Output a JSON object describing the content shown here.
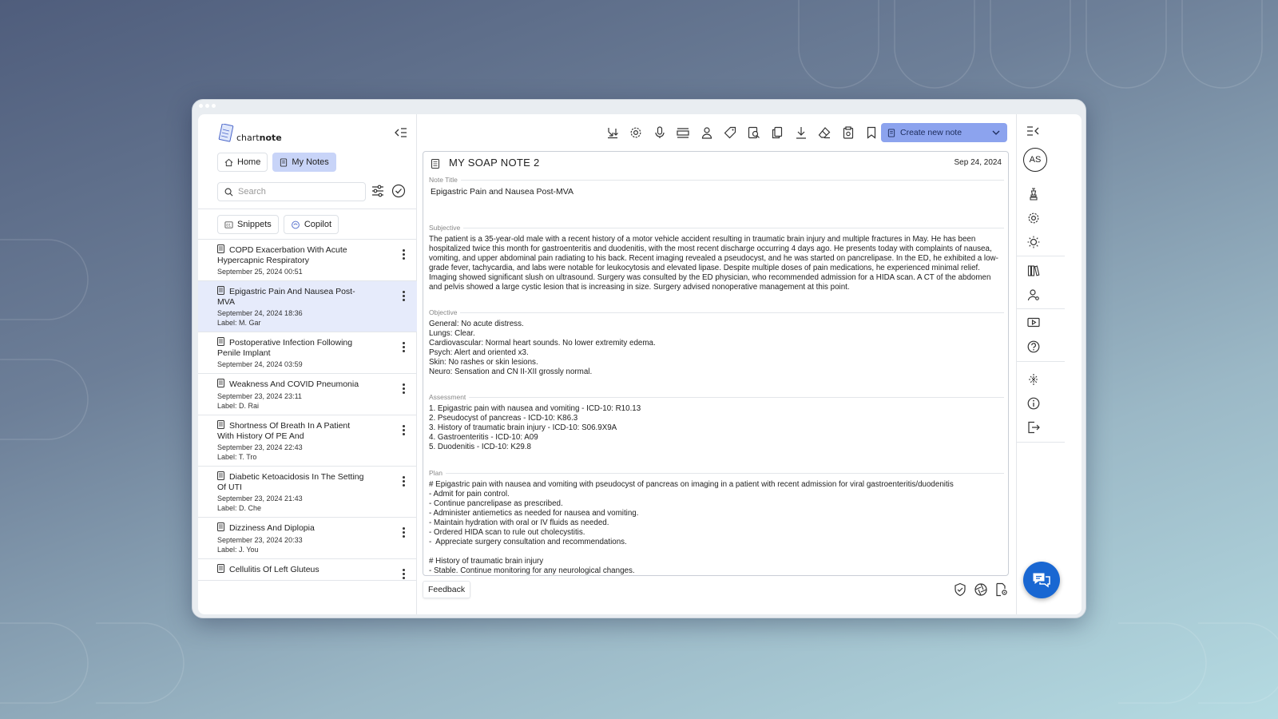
{
  "app": {
    "logo_text_a": "chart",
    "logo_text_b": "note"
  },
  "nav": {
    "home_label": "Home",
    "my_notes_label": "My Notes"
  },
  "search": {
    "placeholder": "Search"
  },
  "tools": {
    "snippets_label": "Snippets",
    "copilot_label": "Copilot"
  },
  "notes": [
    {
      "title": "COPD Exacerbation With Acute Hypercapnic Respiratory",
      "date": "September 25, 2024 00:51",
      "label": ""
    },
    {
      "title": "Epigastric Pain And Nausea Post-MVA",
      "date": "September 24, 2024 18:36",
      "label": "Label: M. Gar"
    },
    {
      "title": "Postoperative Infection Following Penile Implant",
      "date": "September 24, 2024 03:59",
      "label": ""
    },
    {
      "title": "Weakness And COVID Pneumonia",
      "date": "September 23, 2024 23:11",
      "label": "Label: D. Rai"
    },
    {
      "title": "Shortness Of Breath In A Patient With History Of PE And",
      "date": "September 23, 2024 22:43",
      "label": "Label: T. Tro"
    },
    {
      "title": "Diabetic Ketoacidosis In The Setting Of UTI",
      "date": "September 23, 2024 21:43",
      "label": "Label: D. Che"
    },
    {
      "title": "Dizziness And Diplopia",
      "date": "September 23, 2024 20:33",
      "label": "Label: J. You"
    },
    {
      "title": "Cellulitis Of Left Gluteus",
      "date": "",
      "label": ""
    }
  ],
  "toolbar": {
    "create_label": "Create new note"
  },
  "document": {
    "title": "MY SOAP NOTE 2",
    "date": "Sep 24, 2024",
    "note_title_label": "Note Title",
    "note_title_value": "Epigastric Pain and Nausea Post-MVA",
    "subjective_label": "Subjective",
    "subjective_text": "The patient is a 35-year-old male with a recent history of a motor vehicle accident resulting in traumatic brain injury and multiple fractures in May. He has been hospitalized twice this month for gastroenteritis and duodenitis, with the most recent discharge occurring 4 days ago. He presents today with complaints of nausea, vomiting, and upper abdominal pain radiating to his back. Recent imaging revealed a pseudocyst, and he was started on pancrelipase. In the ED, he exhibited a low-grade fever, tachycardia, and labs were notable for leukocytosis and elevated lipase. Despite multiple doses of pain medications, he experienced minimal relief. Imaging showed significant slush on ultrasound. Surgery was consulted by the ED physician, who recommended admission for a HIDA scan. A CT of the abdomen and pelvis showed a large cystic lesion that is increasing in size. Surgery advised nonoperative management at this point.",
    "objective_label": "Objective",
    "objective_text": "General: No acute distress.\nLungs: Clear.\nCardiovascular: Normal heart sounds. No lower extremity edema.\nPsych: Alert and oriented x3.\nSkin: No rashes or skin lesions.\nNeuro: Sensation and CN II-XII grossly normal.",
    "assessment_label": "Assessment",
    "assessment_text": "1. Epigastric pain with nausea and vomiting - ICD-10: R10.13\n2. Pseudocyst of pancreas - ICD-10: K86.3\n3. History of traumatic brain injury - ICD-10: S06.9X9A\n4. Gastroenteritis - ICD-10: A09\n5. Duodenitis - ICD-10: K29.8",
    "plan_label": "Plan",
    "plan_text": "# Epigastric pain with nausea and vomiting with pseudocyst of pancreas on imaging in a patient with recent admission for viral gastroenteritis/duodenitis\n- Admit for pain control.\n- Continue pancrelipase as prescribed.\n- Administer antiemetics as needed for nausea and vomiting.\n- Maintain hydration with oral or IV fluids as needed.\n- Ordered HIDA scan to rule out cholecystitis.\n-  Appreciate surgery consultation and recommendations.\n\n# History of traumatic brain injury\n- Stable. Continue monitoring for any neurological changes."
  },
  "footer": {
    "feedback_label": "Feedback"
  },
  "user": {
    "initials": "AS"
  },
  "colors": {
    "accent": "#8ca3ee",
    "selected_row": "#e6ebfb",
    "chat_button": "#1967d2"
  }
}
